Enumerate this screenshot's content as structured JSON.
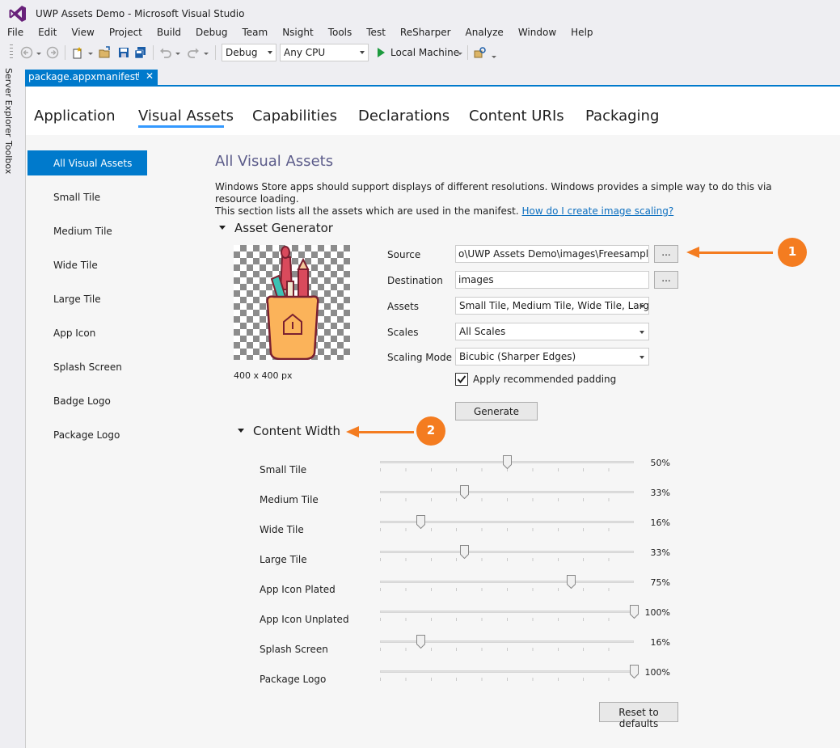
{
  "window": {
    "title": "UWP Assets Demo - Microsoft Visual Studio"
  },
  "menu": [
    "File",
    "Edit",
    "View",
    "Project",
    "Build",
    "Debug",
    "Team",
    "Nsight",
    "Tools",
    "Test",
    "ReSharper",
    "Analyze",
    "Window",
    "Help"
  ],
  "toolbar": {
    "config": "Debug",
    "platform": "Any CPU",
    "run_target": "Local Machine",
    "icons": [
      "back-icon",
      "forward-icon",
      "new-project-icon",
      "open-icon",
      "save-icon",
      "save-all-icon",
      "undo-icon",
      "redo-icon",
      "start-icon",
      "find-icon"
    ]
  },
  "side_tool_tabs": [
    "Server Explorer",
    "Toolbox"
  ],
  "document_tab": {
    "label": "package.appxmanifest",
    "pin": "⊣",
    "close": "✕"
  },
  "page_tabs": [
    "Application",
    "Visual Assets",
    "Capabilities",
    "Declarations",
    "Content URIs",
    "Packaging"
  ],
  "active_page_tab": "Visual Assets",
  "nav": [
    "All Visual Assets",
    "Small Tile",
    "Medium Tile",
    "Wide Tile",
    "Large Tile",
    "App Icon",
    "Splash Screen",
    "Badge Logo",
    "Package Logo"
  ],
  "active_nav": "All Visual Assets",
  "section": {
    "title": "All Visual Assets",
    "desc_line1": "Windows Store apps should support displays of different resolutions. Windows provides a simple way to do this via resource loading.",
    "desc_line2": "This section lists all the assets which are used in the manifest.",
    "desc_link": "How do I create image scaling?"
  },
  "generator": {
    "heading": "Asset Generator",
    "image_size": "400 x 400 px",
    "labels": {
      "source": "Source",
      "destination": "Destination",
      "assets": "Assets",
      "scales": "Scales",
      "scaling_mode": "Scaling Mode"
    },
    "values": {
      "source": "o\\UWP Assets Demo\\images\\Freesample.svg",
      "destination": "images",
      "assets": "Small Tile, Medium Tile, Wide Tile, Larg...",
      "scales": "All Scales",
      "scaling_mode": "Bicubic (Sharper Edges)"
    },
    "browse": "...",
    "padding_label": "Apply recommended padding",
    "padding_checked": true,
    "generate": "Generate"
  },
  "content_width": {
    "heading": "Content Width",
    "sliders": [
      {
        "label": "Small Tile",
        "value": 50,
        "display": "50%"
      },
      {
        "label": "Medium Tile",
        "value": 33,
        "display": "33%"
      },
      {
        "label": "Wide Tile",
        "value": 16,
        "display": "16%"
      },
      {
        "label": "Large Tile",
        "value": 33,
        "display": "33%"
      },
      {
        "label": "App Icon Plated",
        "value": 75,
        "display": "75%"
      },
      {
        "label": "App Icon Unplated",
        "value": 100,
        "display": "100%"
      },
      {
        "label": "Splash Screen",
        "value": 16,
        "display": "16%"
      },
      {
        "label": "Package Logo",
        "value": 100,
        "display": "100%"
      }
    ],
    "reset": "Reset to defaults"
  },
  "callouts": [
    "1",
    "2"
  ],
  "colors": {
    "accent": "#007acc",
    "callout": "#f47c20",
    "heading": "#5c5c8a",
    "link": "#0e70c0"
  }
}
